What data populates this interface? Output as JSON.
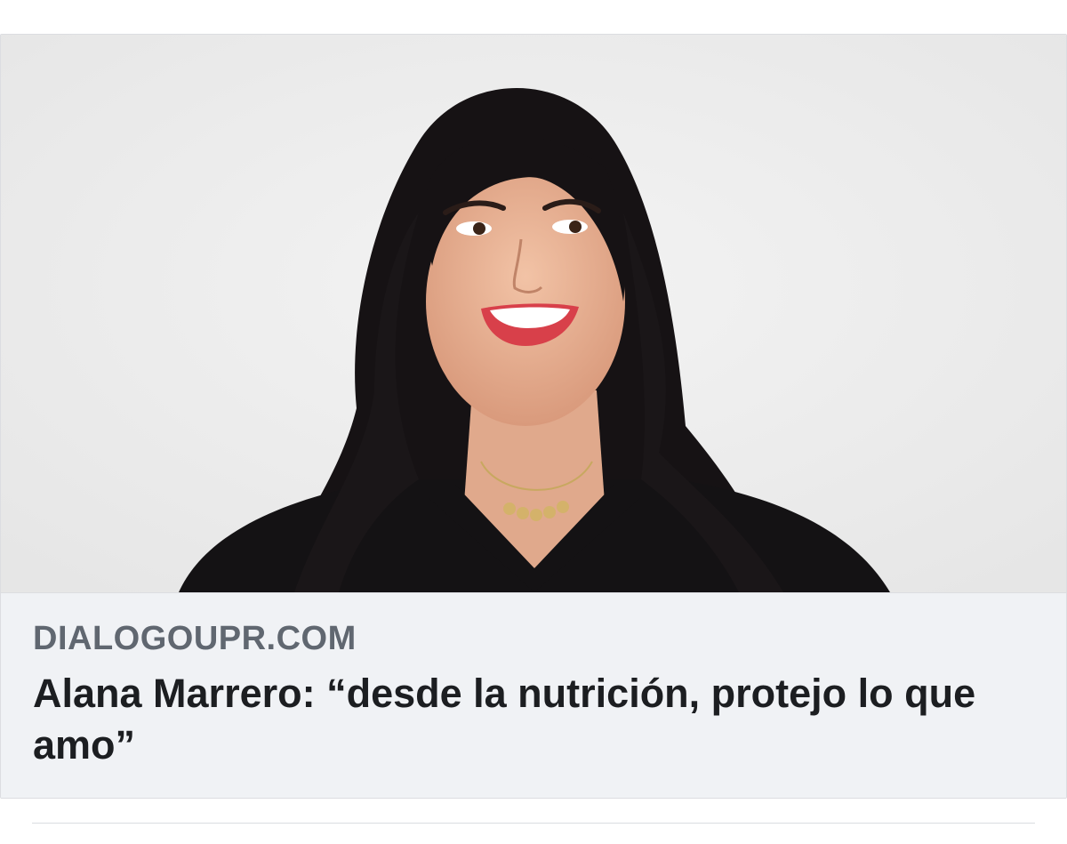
{
  "link_preview": {
    "image": {
      "subject": "Alana Marrero",
      "background_color": "#eeeeee"
    },
    "domain": "DIALOGOUPR.COM",
    "title": "Alana Marrero: “desde la nutrición, protejo lo que amo”"
  },
  "colors": {
    "meta_background": "#f0f2f5",
    "domain_text": "#606770",
    "title_text": "#1c1e21",
    "border": "#dcdde1"
  }
}
